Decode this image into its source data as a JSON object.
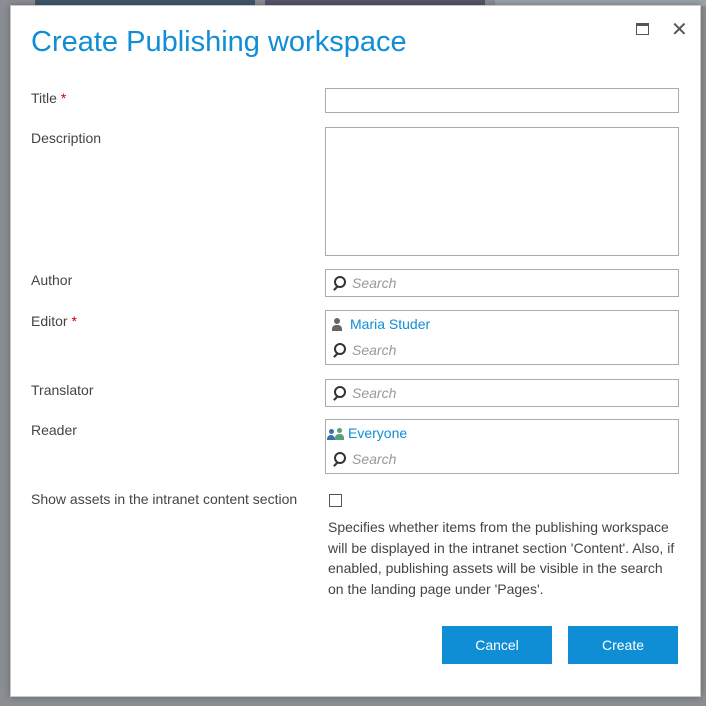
{
  "dialog": {
    "title": "Create Publishing workspace",
    "maximize_icon": "maximize-icon",
    "close_icon": "close-icon"
  },
  "fields": {
    "title": {
      "label": "Title",
      "required": "*",
      "value": ""
    },
    "description": {
      "label": "Description",
      "value": ""
    },
    "author": {
      "label": "Author",
      "placeholder": "Search"
    },
    "editor": {
      "label": "Editor",
      "required": "*",
      "person": "Maria Studer",
      "placeholder": "Search"
    },
    "translator": {
      "label": "Translator",
      "placeholder": "Search"
    },
    "reader": {
      "label": "Reader",
      "person": "Everyone",
      "placeholder": "Search"
    },
    "show_assets": {
      "label": "Show assets in the intranet content section",
      "checked": false,
      "help": "Specifies whether items from the publishing workspace will be displayed in the intranet section 'Content'. Also, if enabled, publishing assets will be visible in the search on the landing page under 'Pages'."
    }
  },
  "buttons": {
    "cancel": "Cancel",
    "create": "Create"
  },
  "colors": {
    "accent": "#0f8ed6",
    "required": "#cc0000"
  }
}
